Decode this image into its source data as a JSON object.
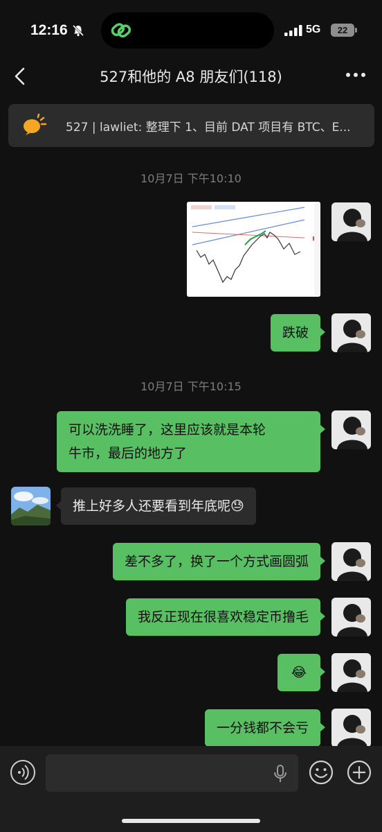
{
  "status_bar": {
    "time": "12:16",
    "network": "5G",
    "battery": "22"
  },
  "header": {
    "title": "527和他的 A8 朋友们(118)"
  },
  "pinned": {
    "text": "527 | lawliet: 整理下  1、目前 DAT 项目有 BTC、E..."
  },
  "timestamps": [
    "10月7日 下午10:10",
    "10月7日 下午10:15"
  ],
  "messages": [
    {
      "side": "right",
      "type": "image",
      "content": "chart screenshot"
    },
    {
      "side": "right",
      "type": "text",
      "text": "跌破"
    },
    {
      "side": "right",
      "type": "text",
      "line1": "可以洗洗睡了，这里应该就是本轮",
      "line2": "牛市，最后的地方了"
    },
    {
      "side": "left",
      "type": "text",
      "text": "推上好多人还要看到年底呢😓"
    },
    {
      "side": "right",
      "type": "text",
      "text": "差不多了，换了一个方式画圆弧"
    },
    {
      "side": "right",
      "type": "text",
      "text": "我反正现在很喜欢稳定币撸毛"
    },
    {
      "side": "right",
      "type": "text",
      "text": "😂"
    },
    {
      "side": "right",
      "type": "text",
      "text": "一分钱都不会亏"
    }
  ],
  "colors": {
    "bubble_self": "#58c062",
    "bubble_other": "#2c2c2c",
    "background": "#111111"
  },
  "icons": [
    "back-icon",
    "more-icon",
    "speaker-icon",
    "voice-icon",
    "mic-icon",
    "emoji-icon",
    "plus-icon"
  ]
}
